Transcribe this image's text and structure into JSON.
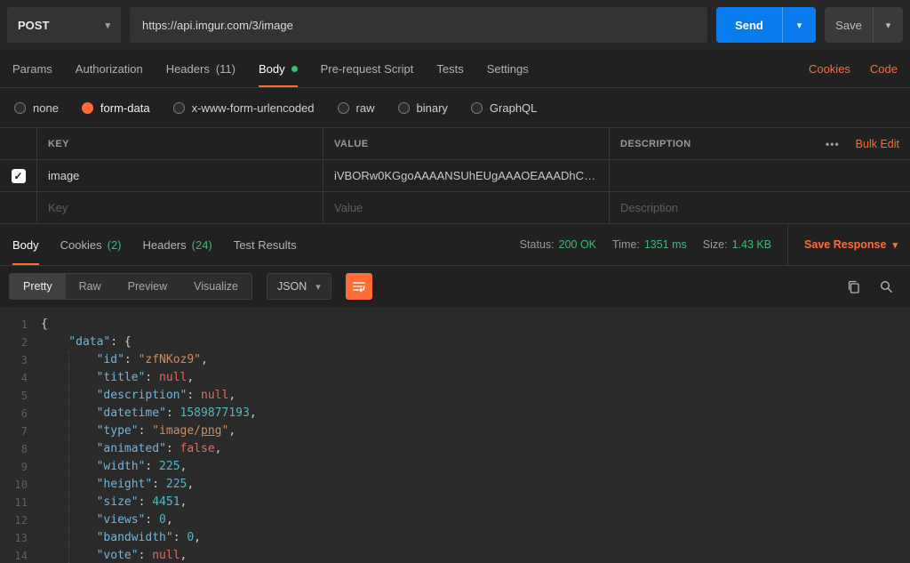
{
  "request_bar": {
    "method": "POST",
    "url": "https://api.imgur.com/3/image",
    "send_label": "Send",
    "save_label": "Save"
  },
  "request_tabs": {
    "items": [
      {
        "label": "Params"
      },
      {
        "label": "Authorization"
      },
      {
        "label": "Headers",
        "count": "(11)"
      },
      {
        "label": "Body"
      },
      {
        "label": "Pre-request Script"
      },
      {
        "label": "Tests"
      },
      {
        "label": "Settings"
      }
    ],
    "cookies": "Cookies",
    "code": "Code"
  },
  "body_type": {
    "options": [
      "none",
      "form-data",
      "x-www-form-urlencoded",
      "raw",
      "binary",
      "GraphQL"
    ],
    "selected": "form-data"
  },
  "form_data_table": {
    "headers": {
      "key": "KEY",
      "value": "VALUE",
      "description": "DESCRIPTION"
    },
    "more": "•••",
    "bulk_edit": "Bulk Edit",
    "rows": [
      {
        "checked": true,
        "key": "image",
        "value": "iVBORw0KGgoAAAANSUhEUgAAAOEAAADhCAM…",
        "description": ""
      }
    ],
    "placeholders": {
      "key": "Key",
      "value": "Value",
      "description": "Description"
    }
  },
  "response_meta": {
    "tabs": [
      {
        "label": "Body"
      },
      {
        "label": "Cookies",
        "count": "(2)"
      },
      {
        "label": "Headers",
        "count": "(24)"
      },
      {
        "label": "Test Results"
      }
    ],
    "status_label": "Status:",
    "status_value": "200 OK",
    "time_label": "Time:",
    "time_value": "1351 ms",
    "size_label": "Size:",
    "size_value": "1.43 KB",
    "save_response": "Save Response"
  },
  "response_toolbar": {
    "modes": [
      "Pretty",
      "Raw",
      "Preview",
      "Visualize"
    ],
    "active_mode": "Pretty",
    "language": "JSON"
  },
  "colors": {
    "accent_orange": "#ff6c37",
    "send_blue": "#097bed",
    "success_green": "#3eba7c"
  },
  "response_body": {
    "lines": [
      {
        "n": 1,
        "toks": [
          [
            "pn",
            "{"
          ]
        ]
      },
      {
        "n": 2,
        "toks": [
          [
            "ws",
            "    "
          ],
          [
            "key",
            "\"data\""
          ],
          [
            "pn",
            ": {"
          ]
        ]
      },
      {
        "n": 3,
        "toks": [
          [
            "ws",
            "        "
          ],
          [
            "key",
            "\"id\""
          ],
          [
            "pn",
            ": "
          ],
          [
            "str",
            "\"zfNKoz9\""
          ],
          [
            "pn",
            ","
          ]
        ]
      },
      {
        "n": 4,
        "toks": [
          [
            "ws",
            "        "
          ],
          [
            "key",
            "\"title\""
          ],
          [
            "pn",
            ": "
          ],
          [
            "kw",
            "null"
          ],
          [
            "pn",
            ","
          ]
        ]
      },
      {
        "n": 5,
        "toks": [
          [
            "ws",
            "        "
          ],
          [
            "key",
            "\"description\""
          ],
          [
            "pn",
            ": "
          ],
          [
            "kw",
            "null"
          ],
          [
            "pn",
            ","
          ]
        ]
      },
      {
        "n": 6,
        "toks": [
          [
            "ws",
            "        "
          ],
          [
            "key",
            "\"datetime\""
          ],
          [
            "pn",
            ": "
          ],
          [
            "num",
            "1589877193"
          ],
          [
            "pn",
            ","
          ]
        ]
      },
      {
        "n": 7,
        "toks": [
          [
            "ws",
            "        "
          ],
          [
            "key",
            "\"type\""
          ],
          [
            "pn",
            ": "
          ],
          [
            "str",
            "\"image/"
          ],
          [
            "stru",
            "png"
          ],
          [
            "str",
            "\""
          ],
          [
            "pn",
            ","
          ]
        ]
      },
      {
        "n": 8,
        "toks": [
          [
            "ws",
            "        "
          ],
          [
            "key",
            "\"animated\""
          ],
          [
            "pn",
            ": "
          ],
          [
            "kw",
            "false"
          ],
          [
            "pn",
            ","
          ]
        ]
      },
      {
        "n": 9,
        "toks": [
          [
            "ws",
            "        "
          ],
          [
            "key",
            "\"width\""
          ],
          [
            "pn",
            ": "
          ],
          [
            "num",
            "225"
          ],
          [
            "pn",
            ","
          ]
        ]
      },
      {
        "n": 10,
        "toks": [
          [
            "ws",
            "        "
          ],
          [
            "key",
            "\"height\""
          ],
          [
            "pn",
            ": "
          ],
          [
            "num",
            "225"
          ],
          [
            "pn",
            ","
          ]
        ]
      },
      {
        "n": 11,
        "toks": [
          [
            "ws",
            "        "
          ],
          [
            "key",
            "\"size\""
          ],
          [
            "pn",
            ": "
          ],
          [
            "num",
            "4451"
          ],
          [
            "pn",
            ","
          ]
        ]
      },
      {
        "n": 12,
        "toks": [
          [
            "ws",
            "        "
          ],
          [
            "key",
            "\"views\""
          ],
          [
            "pn",
            ": "
          ],
          [
            "num",
            "0"
          ],
          [
            "pn",
            ","
          ]
        ]
      },
      {
        "n": 13,
        "toks": [
          [
            "ws",
            "        "
          ],
          [
            "key",
            "\"bandwidth\""
          ],
          [
            "pn",
            ": "
          ],
          [
            "num",
            "0"
          ],
          [
            "pn",
            ","
          ]
        ]
      },
      {
        "n": 14,
        "toks": [
          [
            "ws",
            "        "
          ],
          [
            "key",
            "\"vote\""
          ],
          [
            "pn",
            ": "
          ],
          [
            "kw",
            "null"
          ],
          [
            "pn",
            ","
          ]
        ]
      }
    ]
  }
}
